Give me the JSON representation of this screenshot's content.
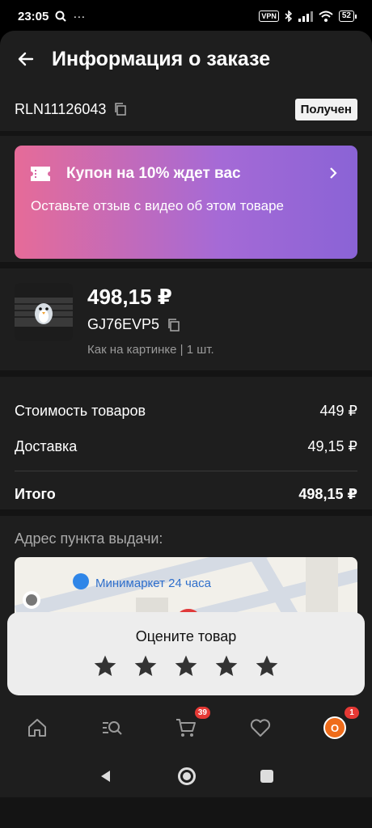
{
  "status_bar": {
    "time": "23:05",
    "vpn": "VPN",
    "battery": "52"
  },
  "header": {
    "title": "Информация о заказе"
  },
  "order": {
    "number": "RLN11126043",
    "status": "Получен"
  },
  "coupon": {
    "title": "Купон на 10% ждет вас",
    "text": "Оставьте отзыв с видео об этом товаре"
  },
  "product": {
    "price": "498,15 ₽",
    "sku": "GJ76EVP5",
    "variant": "Как на картинке | 1 шт."
  },
  "totals": {
    "goods_label": "Стоимость товаров",
    "goods_value": "449 ₽",
    "delivery_label": "Доставка",
    "delivery_value": "49,15 ₽",
    "total_label": "Итого",
    "total_value": "498,15 ₽"
  },
  "address": {
    "label": "Адрес пункта выдачи:",
    "map_poi": "Минимаркет 24 часа"
  },
  "rating": {
    "title": "Оцените товар",
    "stars": 5
  },
  "tabbar": {
    "cart_badge": "39",
    "profile_badge": "1",
    "avatar_letter": "O"
  },
  "colors": {
    "coupon_start": "#e66b98",
    "coupon_end": "#8a63d6",
    "badge": "#e53935",
    "background": "#141414"
  }
}
